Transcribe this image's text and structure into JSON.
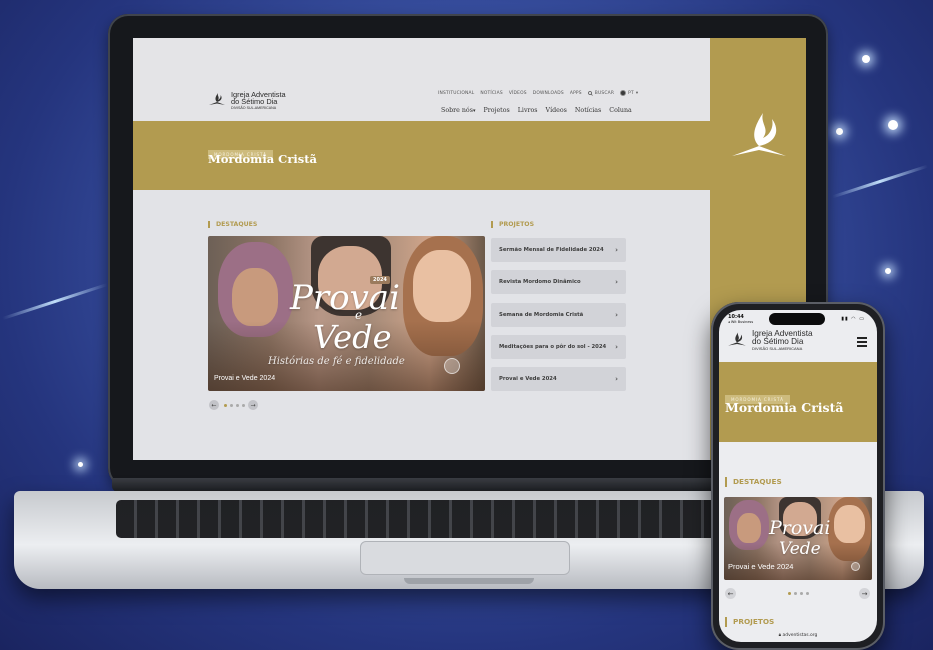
{
  "site": {
    "logo": {
      "line1": "Igreja Adventista",
      "line2": "do Sétimo Dia",
      "line3": "DIVISÃO SUL-AMERICANA"
    },
    "top_nav": [
      "INSTITUCIONAL",
      "NOTÍCIAS",
      "VÍDEOS",
      "DOWNLOADS",
      "APPS",
      "BUSCAR",
      "PT"
    ],
    "main_nav": [
      "Sobre nós",
      "Projetos",
      "Livros",
      "Vídeos",
      "Notícias",
      "Coluna"
    ],
    "hero": {
      "tag": "MORDOMIA CRISTÃ",
      "title": "Mordomia Cristã"
    },
    "destaques": {
      "heading": "DESTAQUES",
      "banner": {
        "word1": "Provai",
        "word_e": "e",
        "word2": "Vede",
        "year": "2024",
        "subtitle": "Histórias de fé e fidelidade",
        "caption": "Provai e Vede 2024"
      }
    },
    "projetos": {
      "heading": "PROJETOS",
      "items": [
        "Sermão Mensal de Fidelidade 2024",
        "Revista Mordomo Dinâmico",
        "Semana de Mordomia Cristã",
        "Meditações para o pôr do sol - 2024",
        "Provai e Vede 2024"
      ]
    }
  },
  "phone": {
    "status": {
      "time": "10:44",
      "carrier": "◂ Wit Business"
    },
    "footer_url": "adventistas.org"
  },
  "icons": {
    "search": "search-icon",
    "globe": "globe-icon",
    "menu": "hamburger-menu-icon",
    "logo": "church-flame-bible-icon"
  },
  "colors": {
    "gold": "#b29b50",
    "page_bg": "#e2e3e7",
    "item_bg": "#d2d3d8"
  }
}
